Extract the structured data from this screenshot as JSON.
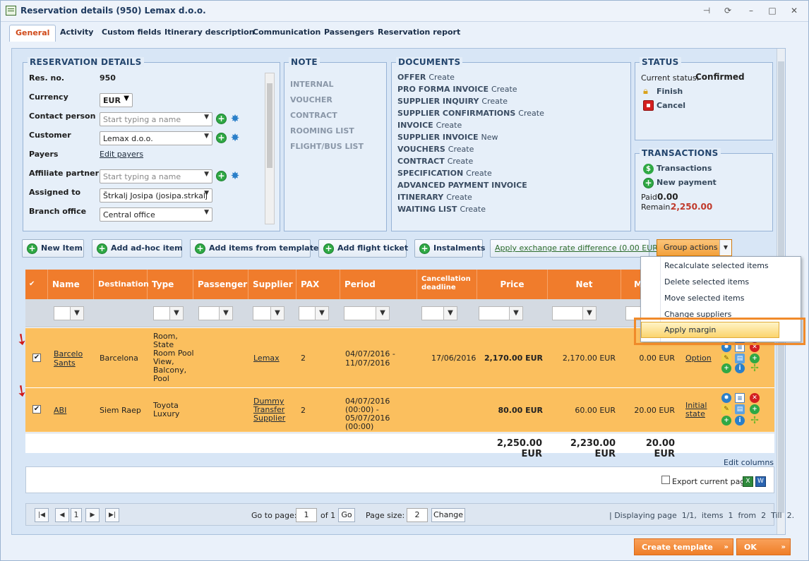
{
  "window": {
    "title": "Reservation details (950) Lemax d.o.o."
  },
  "tabs": [
    "General",
    "Activity",
    "Custom fields",
    "Itinerary description",
    "Communication",
    "Passengers",
    "Reservation report"
  ],
  "reservation": {
    "section_title": "RESERVATION DETAILS",
    "res_no_label": "Res. no.",
    "res_no": "950",
    "currency_label": "Currency",
    "currency": "EUR",
    "contact_label": "Contact person",
    "contact_placeholder": "Start typing a name",
    "customer_label": "Customer",
    "customer": "Lemax d.o.o.",
    "payers_label": "Payers",
    "payers_link": "Edit payers",
    "affiliate_label": "Affiliate partner",
    "affiliate_placeholder": "Start typing a name",
    "assigned_label": "Assigned to",
    "assigned": "Štrkalj Josipa (josipa.strkalj",
    "branch_label": "Branch office",
    "branch": "Central office"
  },
  "note": {
    "section_title": "NOTE",
    "items": [
      "INTERNAL",
      "VOUCHER",
      "CONTRACT",
      "ROOMING LIST",
      "FLIGHT/BUS LIST"
    ]
  },
  "documents": {
    "section_title": "DOCUMENTS",
    "items": [
      {
        "name": "OFFER",
        "action": "Create"
      },
      {
        "name": "PRO FORMA INVOICE",
        "action": "Create"
      },
      {
        "name": "SUPPLIER INQUIRY",
        "action": "Create"
      },
      {
        "name": "SUPPLIER CONFIRMATIONS",
        "action": "Create"
      },
      {
        "name": "INVOICE",
        "action": "Create"
      },
      {
        "name": "SUPPLIER INVOICE",
        "action": "New"
      },
      {
        "name": "VOUCHERS",
        "action": "Create"
      },
      {
        "name": "CONTRACT",
        "action": "Create"
      },
      {
        "name": "SPECIFICATION",
        "action": "Create"
      },
      {
        "name": "ADVANCED PAYMENT INVOICE",
        "action": ""
      },
      {
        "name": "ITINERARY",
        "action": "Create"
      },
      {
        "name": "WAITING LIST",
        "action": "Create"
      }
    ]
  },
  "status": {
    "section_title": "STATUS",
    "current_label": "Current status:",
    "current": "Confirmed",
    "finish": "Finish",
    "cancel": "Cancel"
  },
  "transactions": {
    "section_title": "TRANSACTIONS",
    "transactions_link": "Transactions",
    "new_payment": "New payment",
    "paid_label": "Paid",
    "paid": "0.00",
    "remain_label": "Remain.",
    "remain": "2,250.00"
  },
  "actions": {
    "new_item": "New Item",
    "adhoc": "Add ad-hoc item",
    "template": "Add items from template",
    "flight": "Add flight ticket",
    "instalments": "Instalments",
    "exchange": "Apply exchange rate difference (0.00 EUR)",
    "group": "Group actions"
  },
  "group_menu": [
    "Recalculate selected items",
    "Delete selected items",
    "Move selected items",
    "Change suppliers",
    "Apply margin"
  ],
  "grid": {
    "headers": [
      "Name",
      "Destination",
      "Type",
      "Passenger",
      "Supplier",
      "PAX",
      "Period",
      "Cancellation deadline",
      "Price",
      "Net",
      "M"
    ],
    "rows": [
      {
        "name": "Barcelo Sants",
        "destination": "Barcelona",
        "type": "Room, State Room Pool View, Balcony, Pool",
        "passenger": "",
        "supplier": "Lemax",
        "pax": "2",
        "period": "04/07/2016 - 11/07/2016",
        "cancellation": "17/06/2016",
        "price": "2,170.00 EUR",
        "net": "2,170.00 EUR",
        "margin": "0.00 EUR",
        "status": "Option"
      },
      {
        "name": "ABI",
        "destination": "Siem Raep",
        "type": "Toyota Luxury",
        "passenger": "",
        "supplier": "Dummy Transfer Supplier",
        "pax": "2",
        "period": "04/07/2016 (00:00) - 05/07/2016 (00:00)",
        "cancellation": "",
        "price": "80.00 EUR",
        "net": "60.00 EUR",
        "margin": "20.00 EUR",
        "status": "Initial state"
      }
    ],
    "totals": {
      "price": "2,250.00 EUR",
      "net": "2,230.00 EUR",
      "margin": "20.00 EUR"
    },
    "edit_columns": "Edit columns",
    "export": "Export current page"
  },
  "pager": {
    "page": "1",
    "goto_label": "Go to page:",
    "goto_value": "1",
    "of": "of 1",
    "go": "Go",
    "size_label": "Page size:",
    "size": "2",
    "change": "Change",
    "info": "| Displaying page  1/1,  items  1  from  2  Till  2."
  },
  "footer": {
    "create_template": "Create template",
    "ok": "OK"
  }
}
